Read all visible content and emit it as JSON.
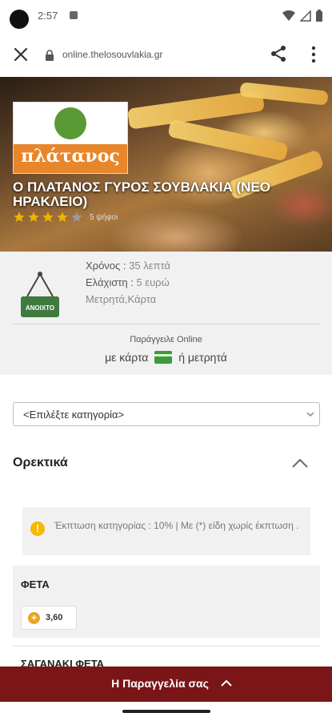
{
  "status_bar": {
    "time": "2:57"
  },
  "browser": {
    "url": "online.thelosouvlakia.gr"
  },
  "hero": {
    "logo_text": "πλάτανος",
    "title": "Ο ΠΛΑΤΑΝΟΣ ΓΥΡΟΣ ΣΟΥΒΛΑΚΙΑ (ΝΕΟ ΗΡΑΚΛΕΙΟ)",
    "rating": 4,
    "rating_max": 5,
    "rating_text": "5 ψήφοι"
  },
  "info": {
    "open_sign": "ΑΝΟΙΧΤΟ",
    "time_label": "Χρόνος : ",
    "time_value": "35 λεπτά",
    "min_label": "Ελάχιστη : ",
    "min_value": "5 ευρώ",
    "payment_methods": "Μετρητά,Κάρτα",
    "order_online": "Παράγγειλε Online",
    "pay_card": "με κάρτα",
    "pay_cash": "ή μετρητά"
  },
  "category_select": {
    "selected": "<Επιλέξτε κατηγορία>"
  },
  "section": {
    "title": "Ορεκτικά"
  },
  "notice": {
    "text": "Έκπτωση κατηγορίας : 10% | Με (*) είδη χωρίς έκπτωση ."
  },
  "products": [
    {
      "name": "ΦΕΤΑ",
      "price": "3,60"
    },
    {
      "name": "ΣΑΓΑΝΑΚΙ ΦΕΤΑ"
    }
  ],
  "order_bar": {
    "label": "Η Παραγγελία σας"
  },
  "colors": {
    "accent": "#7a1617",
    "star": "#f0b400",
    "open_sign": "#3f7a3f"
  }
}
